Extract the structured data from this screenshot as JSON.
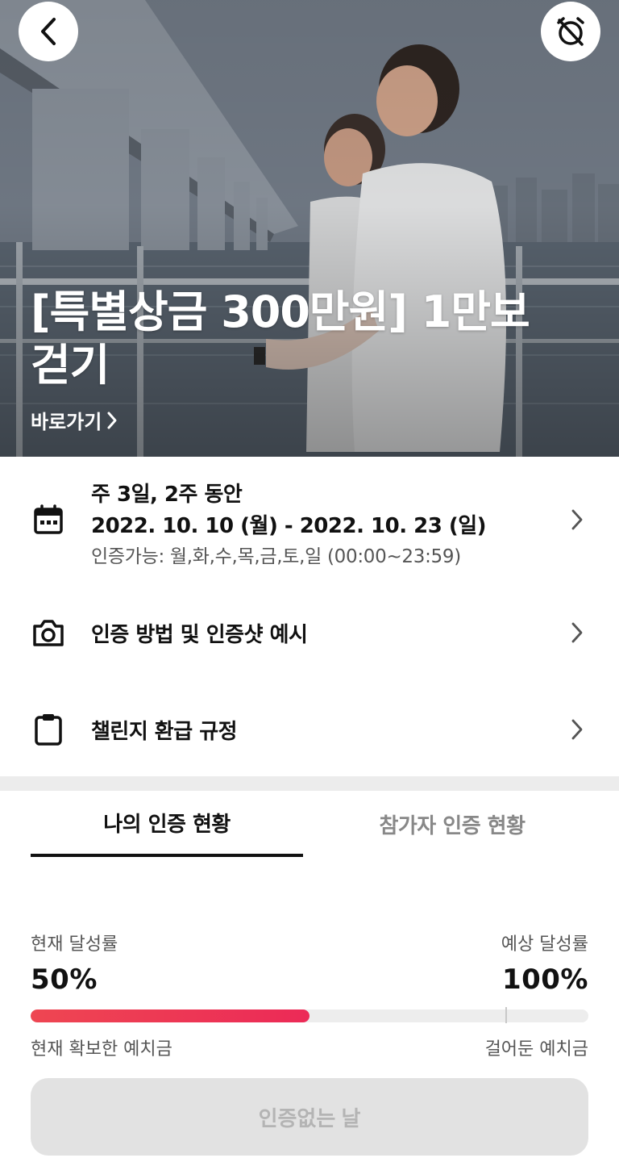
{
  "hero": {
    "title": "[특별상금 300만원] 1만보 걷기",
    "link_label": "바로가기"
  },
  "schedule": {
    "frequency": "주 3일, 2주 동안",
    "period": "2022. 10. 10 (월) - 2022. 10. 23 (일)",
    "available": "인증가능: 월,화,수,목,금,토,일 (00:00~23:59)"
  },
  "menu": {
    "method_label": "인증 방법 및 인증샷 예시",
    "refund_label": "챌린지 환급 규정"
  },
  "tabs": [
    {
      "label": "나의 인증 현황",
      "active": true
    },
    {
      "label": "참가자 인증 현황",
      "active": false
    }
  ],
  "stats": {
    "current_label": "현재 달성률",
    "current_value": "50%",
    "expected_label": "예상 달성률",
    "expected_value": "100%",
    "progress_fraction": 0.5,
    "secured_label": "현재 확보한 예치금",
    "deposited_label": "걸어둔 예치금"
  },
  "cta_label": "인증없는 날",
  "icons": {
    "back": "chevron-left-icon",
    "alarm": "alarm-off-icon",
    "calendar": "calendar-icon",
    "camera": "camera-icon",
    "clipboard": "clipboard-icon",
    "chevron": "chevron-right-icon"
  },
  "colors": {
    "progress": "#ec2a57",
    "tab_active": "#111111",
    "tab_inactive": "#888888",
    "cta_bg": "#e2e2e2",
    "cta_text": "#b4b4b4"
  }
}
